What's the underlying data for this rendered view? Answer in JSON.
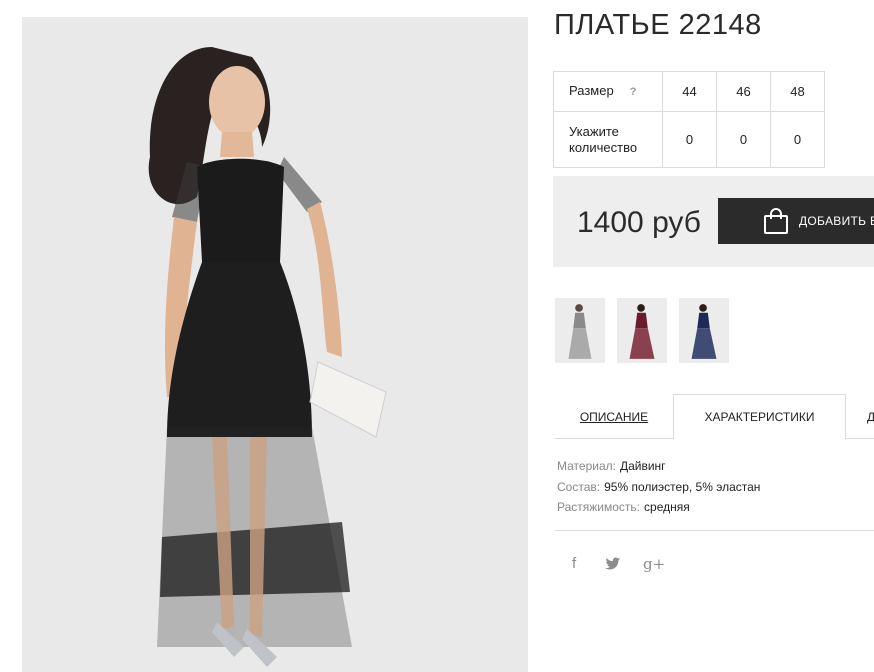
{
  "product": {
    "title": "ПЛАТЬЕ 22148",
    "photo_icon": "dress-model-photo"
  },
  "sizes": {
    "size_label": "Размер",
    "help_icon": "?",
    "qty_label_line1": "Укажите",
    "qty_label_line2": "количество",
    "columns": [
      "44",
      "46",
      "48"
    ],
    "quantities": [
      "0",
      "0",
      "0"
    ]
  },
  "purchase": {
    "price": "1400 руб",
    "add_button": "ДОБАВИТЬ В",
    "bag_icon": "shopping-bag-icon"
  },
  "thumbnails": [
    {
      "color": "#8a8a8a",
      "icon": "dress-thumbnail-gray"
    },
    {
      "color": "#6a1c2e",
      "icon": "dress-thumbnail-burgundy"
    },
    {
      "color": "#1d2a55",
      "icon": "dress-thumbnail-navy"
    }
  ],
  "tabs": {
    "description": "ОПИСАНИЕ",
    "characteristics": "ХАРАКТЕРИСТИКИ",
    "more": "Д"
  },
  "characteristics": [
    {
      "key": "Материал:",
      "value": "Дайвинг"
    },
    {
      "key": "Состав:",
      "value": "95% полиэстер, 5% эластан"
    },
    {
      "key": "Растяжимость:",
      "value": "средняя"
    }
  ],
  "social": {
    "facebook": "f",
    "twitter": "twitter-bird",
    "google_plus": "g+"
  },
  "colors": {
    "dark": "#2b2b2b",
    "panel": "#eeeeee",
    "border": "#dcdcdc",
    "muted": "#888888"
  }
}
